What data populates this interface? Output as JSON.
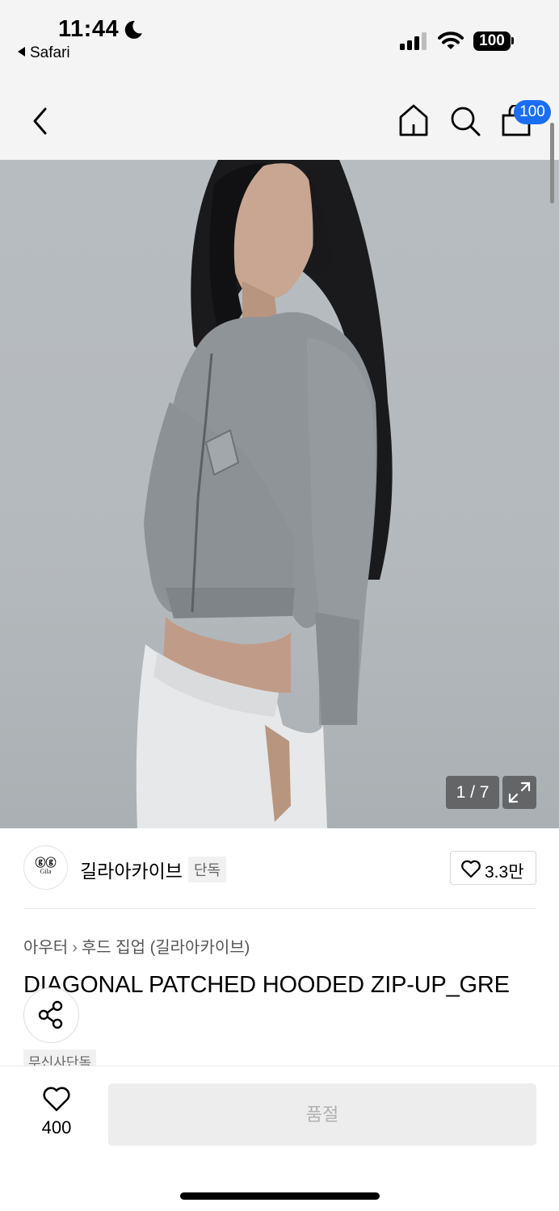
{
  "status_bar": {
    "time": "11:44",
    "back_app": "Safari",
    "battery": "100"
  },
  "nav": {
    "cart_count": "100"
  },
  "gallery": {
    "counter": "1 / 7"
  },
  "brand": {
    "logo_text": "Gila",
    "name": "길라아카이브",
    "tag": "단독",
    "likes": "3.3만"
  },
  "breadcrumb": {
    "category": "아우터",
    "subcategory": "후드 집업 (길라아카이브)"
  },
  "product": {
    "title": "DIAGONAL PATCHED HOODED ZIP-UP_GRE",
    "exclusive_tag": "무신사단독"
  },
  "bottom_bar": {
    "like_count": "400",
    "buy_label": "품절"
  },
  "colors": {
    "accent": "#1a6ef2",
    "disabled_button": "#ededed"
  }
}
